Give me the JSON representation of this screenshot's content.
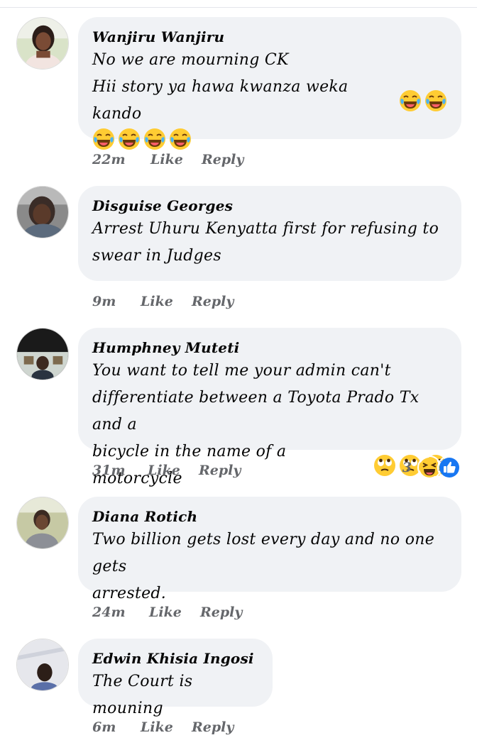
{
  "comments": [
    {
      "author": "Wanjiru Wanjiru",
      "lines": [
        "No we are mourning CK",
        "Hii story ya hawa kwanza weka kando"
      ],
      "time": "22m",
      "like_label": "Like",
      "reply_label": "Reply",
      "emoji": "face-with-tears-of-joy-icon",
      "emoji_count": 6
    },
    {
      "author": "Disguise Georges",
      "lines": [
        "Arrest Uhuru Kenyatta first for refusing to",
        "swear in Judges"
      ],
      "time": "9m",
      "like_label": "Like",
      "reply_label": "Reply"
    },
    {
      "author": "Humphney Muteti",
      "lines": [
        "You want to tell me your admin can't",
        "differentiate between a Toyota Prado Tx and a",
        "bicycle in the name of a motorcycle"
      ],
      "time": "31m",
      "like_label": "Like",
      "reply_label": "Reply",
      "emoji": "face-with-rolling-eyes-icon",
      "emoji_count": 3,
      "reaction_count": "3",
      "reaction_icons": [
        "laughing-face-icon",
        "thumbs-up-icon"
      ]
    },
    {
      "author": "Diana Rotich",
      "lines": [
        "Two billion gets lost every day and no one gets",
        "arrested."
      ],
      "time": "24m",
      "like_label": "Like",
      "reply_label": "Reply"
    },
    {
      "author": "Edwin Khisia Ingosi",
      "lines": [
        "The Court is mouning"
      ],
      "time": "6m",
      "like_label": "Like",
      "reply_label": "Reply"
    }
  ],
  "colors": {
    "bubble": "#f0f2f5",
    "meta": "#65676b",
    "like_blue": "#1877f2",
    "emoji_yellow": "#ffcc33"
  }
}
